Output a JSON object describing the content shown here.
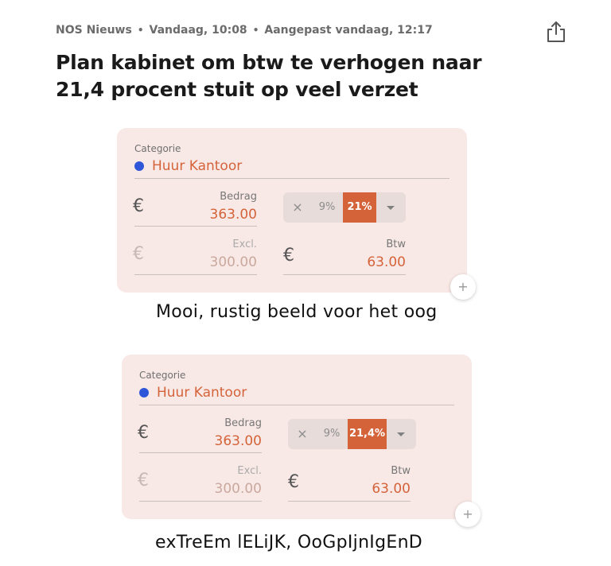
{
  "header": {
    "source": "NOS Nieuws",
    "published": "Vandaag, 10:08",
    "updated": "Aangepast vandaag, 12:17",
    "separator": "•",
    "share_icon": "share-icon"
  },
  "headline": "Plan kabinet om btw te verhogen naar 21,4 procent stuit op veel verzet",
  "cards": [
    {
      "category_label": "Categorie",
      "category_value": "Huur Kantoor",
      "currency": "€",
      "amount_label": "Bedrag",
      "amount_value": "363.00",
      "rate_clear": "×",
      "rate_low": "9%",
      "rate_selected": "21%",
      "excl_label": "Excl.",
      "excl_value": "300.00",
      "btw_label": "Btw",
      "btw_value": "63.00",
      "add_symbol": "+",
      "caption": "Mooi, rustig beeld voor het oog"
    },
    {
      "category_label": "Categorie",
      "category_value": "Huur Kantoor",
      "currency": "€",
      "amount_label": "Bedrag",
      "amount_value": "363.00",
      "rate_clear": "×",
      "rate_low": "9%",
      "rate_selected": "21,4%",
      "excl_label": "Excl.",
      "excl_value": "300.00",
      "btw_label": "Btw",
      "btw_value": "63.00",
      "add_symbol": "+",
      "caption": "exTreEm lELiJK, OoGpIjnIgEnD"
    }
  ],
  "colors": {
    "accent": "#d4633a",
    "card_bg": "#f9e9e6",
    "category_dot": "#2f56d8"
  }
}
